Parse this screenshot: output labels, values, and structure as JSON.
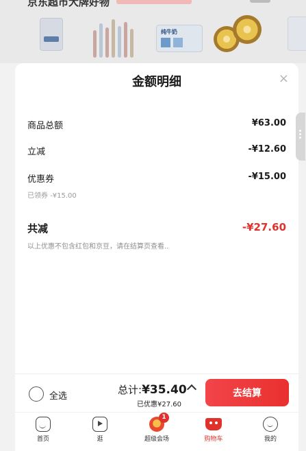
{
  "background": {
    "section_title": "京东超市大牌好物",
    "products": [
      "product-1",
      "product-2",
      "product-3",
      "product-4",
      "product-5"
    ]
  },
  "sheet": {
    "title": "金额明细",
    "close_icon": "close-icon",
    "rows": {
      "goods_total": {
        "label": "商品总额",
        "value": "¥63.00"
      },
      "direct_discount": {
        "label": "立减",
        "value": "-¥12.60"
      },
      "coupon": {
        "label": "优惠券",
        "value": "-¥15.00",
        "note": "已领券 -¥15.00"
      },
      "total_discount": {
        "label": "共减",
        "value": "-¥27.60"
      }
    },
    "note": "以上优惠不包含红包和京豆，请在结算页查看.."
  },
  "bottom_bar": {
    "select_all": "全选",
    "total_label": "总计:",
    "total_value": "¥35.40",
    "saved": "已优惠¥27.60",
    "checkout": "去结算"
  },
  "tabbar": {
    "tabs": [
      {
        "label": "首页",
        "icon": "home-icon"
      },
      {
        "label": "逛",
        "icon": "video-icon"
      },
      {
        "label": "超级会场",
        "icon": "venue-icon",
        "badge": "1"
      },
      {
        "label": "购物车",
        "icon": "cart-icon",
        "active": true
      },
      {
        "label": "我的",
        "icon": "profile-icon"
      }
    ]
  },
  "colors": {
    "accent": "#e0322d",
    "checkout_start": "#f2454a",
    "checkout_end": "#e9302e"
  }
}
